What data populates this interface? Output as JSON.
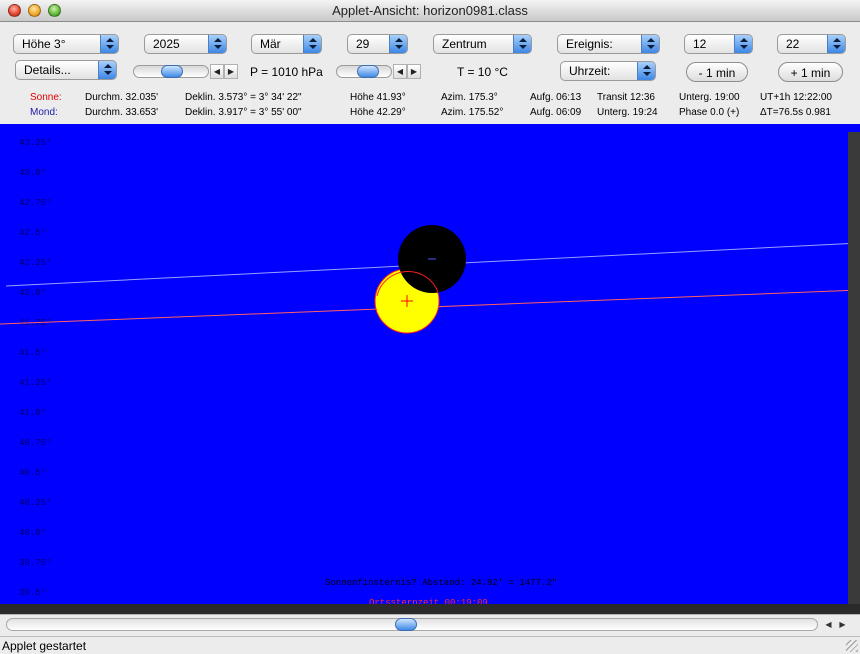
{
  "window": {
    "title": "Applet-Ansicht: horizon0981.class"
  },
  "controls": {
    "hoehe": "Höhe 3°",
    "year": "2025",
    "month": "Mär",
    "day": "29",
    "center": "Zentrum",
    "event": "Ereignis:",
    "hour": "12",
    "minute": "22",
    "details": "Details...",
    "pressure": "P = 1010 hPa",
    "temperature": "T = 10 °C",
    "uhrzeit": "Uhrzeit:",
    "minus_min": "- 1 min",
    "plus_min": "+ 1 min"
  },
  "sun": {
    "label": "Sonne:",
    "durchm": "Durchm. 32.035'",
    "dekl": "Deklin. 3.573° = 3° 34' 22\"",
    "hoehe": "Höhe 41.93°",
    "azim": "Azim. 175.3°",
    "aufg": "Aufg. 06:13",
    "transit": "Transit 12:36",
    "unterg": "Unterg. 19:00",
    "ut": "UT+1h  12:22:00"
  },
  "moon": {
    "label": "Mond:",
    "durchm": "Durchm. 33.653'",
    "dekl": "Deklin. 3.917° = 3° 55' 00\"",
    "hoehe": "Höhe 42.29°",
    "azim": "Azim. 175.52°",
    "aufg": "Aufg. 06:09",
    "unterg": "Unterg. 19:24",
    "phase": "Phase 0.0 (+)",
    "delta": "ΔT=76.5s  0.981"
  },
  "sky": {
    "y_labels": [
      "43.25°",
      "43.0°",
      "42.75°",
      "42.5°",
      "42.25°",
      "42.0°",
      "41.75°",
      "41.5°",
      "41.25°",
      "41.0°",
      "40.75°",
      "40.5°",
      "40.25°",
      "40.0°",
      "39.75°",
      "39.5°"
    ],
    "eclipse_text": "Sonnenfinsternis? Abstand: 24.82' = 1477.2\"",
    "sidereal_text": "Ortssternzeit 00:19:09",
    "sun_color": "#ffff00",
    "moon_color": "#000000",
    "sky_color": "#0000ff"
  },
  "status": {
    "text": "Applet gestartet"
  }
}
